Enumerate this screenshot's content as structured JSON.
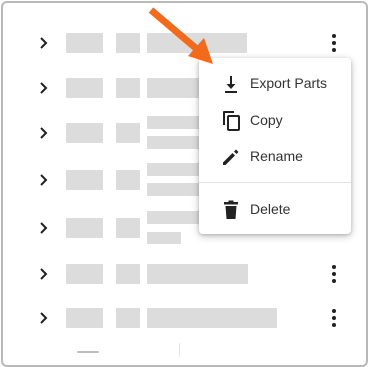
{
  "context_menu": {
    "items": [
      {
        "label": "Export Parts",
        "icon": "download-icon"
      },
      {
        "label": "Copy",
        "icon": "copy-icon"
      },
      {
        "label": "Rename",
        "icon": "pencil-icon"
      },
      {
        "label": "Delete",
        "icon": "trash-icon"
      }
    ]
  },
  "colors": {
    "arrow": "#f26a1b",
    "placeholder": "#dcdcdc",
    "border": "#b9b9b9",
    "text": "#333333"
  }
}
